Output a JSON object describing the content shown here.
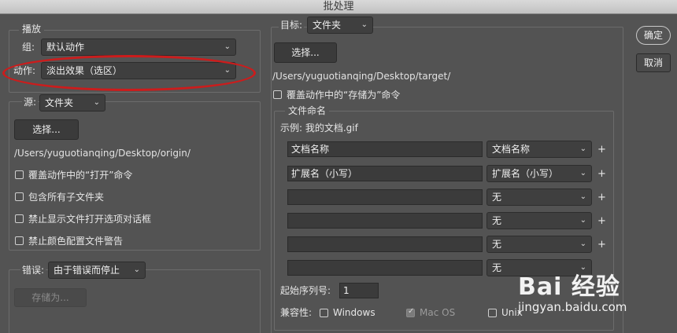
{
  "window": {
    "title": "批处理"
  },
  "play": {
    "legend": "播放",
    "group_label": "组:",
    "group_value": "默认动作",
    "action_label": "动作:",
    "action_value": "淡出效果（选区）"
  },
  "source": {
    "label": "源:",
    "value": "文件夹",
    "choose_label": "选择...",
    "path": "/Users/yuguotianqing/Desktop/origin/",
    "checks": [
      {
        "label": "覆盖动作中的“打开”命令"
      },
      {
        "label": "包含所有子文件夹"
      },
      {
        "label": "禁止显示文件打开选项对话框"
      },
      {
        "label": "禁止颜色配置文件警告"
      }
    ]
  },
  "errors": {
    "label": "错误:",
    "value": "由于错误而停止",
    "save_label": "存储为..."
  },
  "destination": {
    "label": "目标:",
    "value": "文件夹",
    "choose_label": "选择...",
    "path": "/Users/yuguotianqing/Desktop/target/",
    "override_label": "覆盖动作中的“存储为”命令"
  },
  "naming": {
    "legend": "文件命名",
    "example": "示例: 我的文档.gif",
    "rows": [
      {
        "field": "文档名称",
        "select": "文档名称",
        "plus": "+"
      },
      {
        "field": "扩展名（小写）",
        "select": "扩展名（小写）",
        "plus": "+"
      },
      {
        "field": "",
        "select": "无",
        "plus": "+"
      },
      {
        "field": "",
        "select": "无",
        "plus": "+"
      },
      {
        "field": "",
        "select": "无",
        "plus": "+"
      },
      {
        "field": "",
        "select": "无",
        "plus": ""
      }
    ],
    "serial_label": "起始序列号:",
    "serial_value": "1",
    "compat_label": "兼容性:",
    "compat": [
      {
        "label": "Windows",
        "checked": false,
        "disabled": false
      },
      {
        "label": "Mac OS",
        "checked": true,
        "disabled": true
      },
      {
        "label": "Unix",
        "checked": false,
        "disabled": false
      }
    ]
  },
  "buttons": {
    "ok": "确定",
    "cancel": "取消"
  },
  "watermark": {
    "brand": "Bai 经验",
    "url": "jingyan.baidu.com"
  },
  "annotation_color": "#cc1c1c"
}
